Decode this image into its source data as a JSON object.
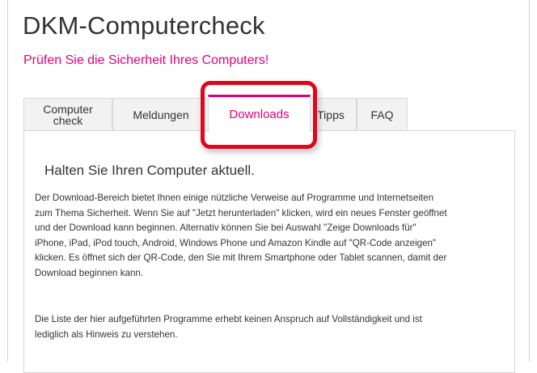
{
  "header": {
    "title": "DKM-Computercheck",
    "subtitle": "Prüfen Sie die Sicherheit Ihres Computers!"
  },
  "tabs": [
    {
      "label": "Computer\ncheck",
      "active": false
    },
    {
      "label": "Meldungen",
      "active": false
    },
    {
      "label": "Downloads",
      "active": true
    },
    {
      "label": "Tipps",
      "active": false
    },
    {
      "label": "FAQ",
      "active": false
    }
  ],
  "content": {
    "heading": "Halten Sie Ihren Computer aktuell.",
    "paragraph1_lines": [
      "Der Download-Bereich bietet Ihnen einige nützliche Verweise auf Programme und Internetseiten",
      "zum Thema Sicherheit. Wenn Sie auf \"Jetzt herunterladen\" klicken, wird ein neues Fenster geöffnet",
      "und der Download kann beginnen. Alternativ können Sie bei Auswahl \"Zeige Downloads für\"",
      "iPhone, iPad, iPod touch, Android, Windows Phone und Amazon Kindle auf \"QR-Code anzeigen\"",
      "klicken. Es öffnet sich der QR-Code, den Sie mit Ihrem Smartphone oder Tablet scannen, damit der",
      "Download beginnen kann."
    ],
    "paragraph2_lines": [
      "Die Liste der hier aufgeführten Programme erhebt keinen Anspruch auf Vollständigkeit und ist",
      "lediglich als Hinweis zu verstehen."
    ]
  },
  "colors": {
    "accent": "#e2007a",
    "highlight": "#e2061a",
    "tab_bg": "#f2f2f2",
    "text": "#333333"
  }
}
